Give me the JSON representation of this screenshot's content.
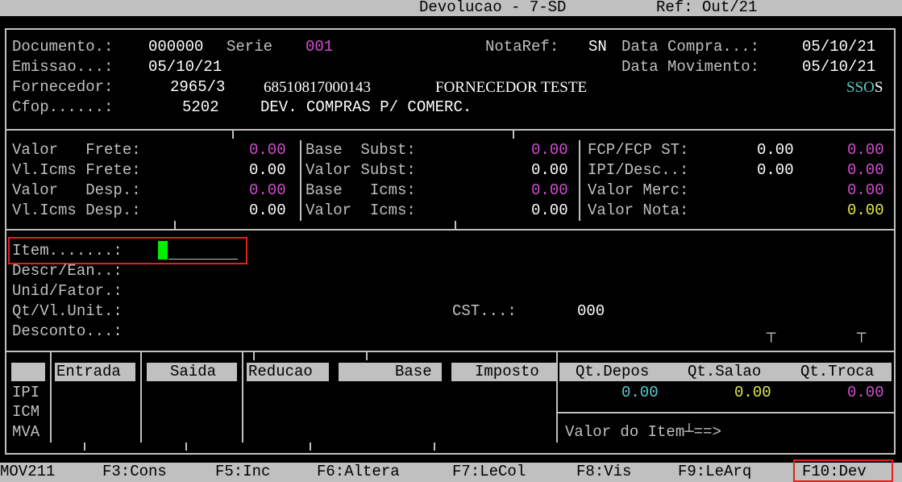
{
  "header": {
    "title": "Devolucao - 7-SD",
    "ref": "Ref: Out/21"
  },
  "doc": {
    "documento_label": "Documento.:",
    "documento": "000000",
    "serie_label": "Serie",
    "serie": "001",
    "notaref_label": "NotaRef:",
    "notaref": "SN",
    "data_compra_label": "Data Compra...:",
    "data_compra": "05/10/21",
    "emissao_label": "Emissao...:",
    "emissao": "05/10/21",
    "data_mov_label": "Data Movimento:",
    "data_mov": "05/10/21",
    "fornecedor_label": "Fornecedor:",
    "fornecedor_cod": "2965/3",
    "cnpj": "68510817000143",
    "fornecedor_nome": "FORNECEDOR TESTE",
    "flags_a": "SSO",
    "flags_b": "S",
    "cfop_label": "Cfop......:",
    "cfop": "5202",
    "cfop_desc": "DEV. COMPRAS P/ COMERC."
  },
  "totals": {
    "col1": [
      {
        "label": "Valor   Frete:",
        "value": "0.00",
        "color": "magenta"
      },
      {
        "label": "Vl.Icms Frete:",
        "value": "0.00",
        "color": "white"
      },
      {
        "label": "Valor   Desp.:",
        "value": "0.00",
        "color": "magenta"
      },
      {
        "label": "Vl.Icms Desp.:",
        "value": "0.00",
        "color": "white"
      }
    ],
    "col2": [
      {
        "label": "Base  Subst:",
        "value": "0.00",
        "color": "magenta"
      },
      {
        "label": "Valor Subst:",
        "value": "0.00",
        "color": "white"
      },
      {
        "label": "Base   Icms:",
        "value": "0.00",
        "color": "magenta"
      },
      {
        "label": "Valor  Icms:",
        "value": "0.00",
        "color": "white"
      }
    ],
    "col3": [
      {
        "label": "FCP/FCP ST:",
        "value_a": "0.00",
        "value_b": "0.00"
      },
      {
        "label": "IPI/Desc..:",
        "value_a": "0.00",
        "value_b": "0.00"
      },
      {
        "label": "Valor Merc:",
        "value_b": "0.00"
      },
      {
        "label": "Valor Nota:",
        "value_b": "0.00"
      }
    ]
  },
  "item": {
    "item_label": "Item.......:",
    "descr_label": "Descr/Ean..:",
    "unid_label": "Unid/Fator.:",
    "qt_label": "Qt/Vl.Unit.:",
    "desconto_label": "Desconto...:",
    "cst_label": "CST...:",
    "cst": "000"
  },
  "tax_table": {
    "headers": [
      "Entrada",
      "Saida",
      "Reducao",
      "Base",
      "Imposto"
    ],
    "rows": [
      "IPI",
      "ICM",
      "MVA"
    ]
  },
  "stock": {
    "headers": [
      "Qt.Depos",
      "Qt.Salao",
      "Qt.Troca"
    ],
    "values": [
      "0.00",
      "0.00",
      "0.00"
    ],
    "valor_item_label": "Valor do Item",
    "arrow": "==>"
  },
  "fkeys": {
    "program": "MOV211",
    "items": [
      "F3:Cons",
      "F5:Inc",
      "F6:Altera",
      "F7:LeCol",
      "F8:Vis",
      "F9:LeArq",
      "F10:Dev"
    ]
  }
}
